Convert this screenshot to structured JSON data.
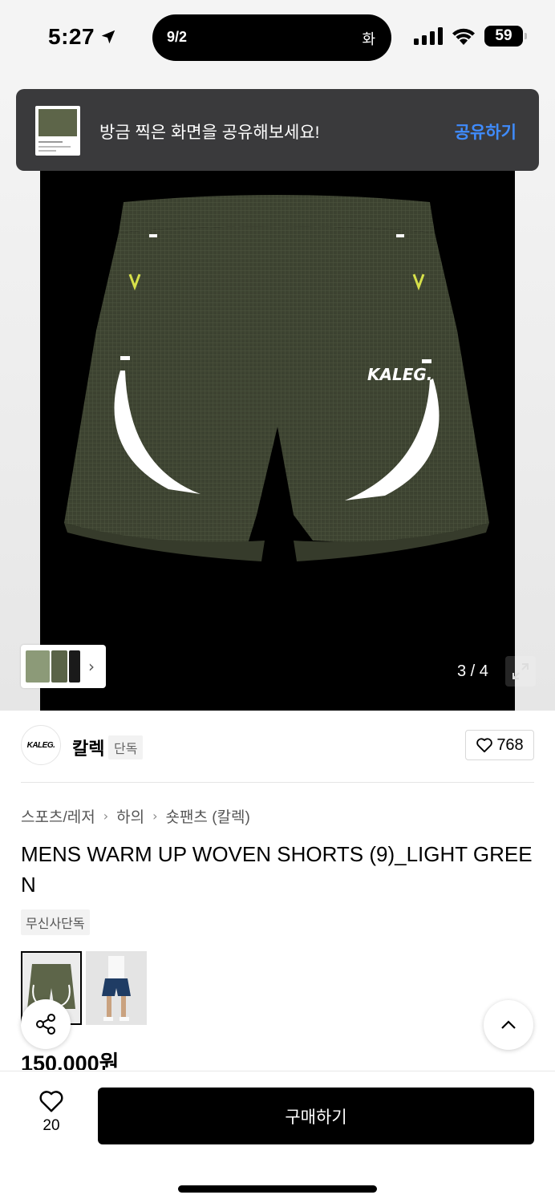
{
  "status_bar": {
    "time": "5:27",
    "island_left": "9/2",
    "island_right": "화",
    "battery": "59"
  },
  "share_banner": {
    "message": "방금 찍은 화면을 공유해보세요!",
    "action": "공유하기"
  },
  "gallery": {
    "counter": "3 / 4",
    "logo_text": "KALEG."
  },
  "brand": {
    "logo_text": "KALEG.",
    "name": "칼렉",
    "badge": "단독",
    "likes": "768"
  },
  "breadcrumb": {
    "items": [
      "스포츠/레저",
      "하의",
      "숏팬츠 (칼렉)"
    ]
  },
  "product": {
    "title": "MENS WARM UP WOVEN SHORTS (9)_LIGHT GREEN",
    "tag": "무신사단독",
    "price": "150,000원"
  },
  "bottom_bar": {
    "wish_count": "20",
    "buy_label": "구매하기"
  },
  "colors": {
    "accent_blue": "#3f8cff",
    "banner_bg": "#3a3a3c",
    "shorts_green": "#3f4533"
  }
}
